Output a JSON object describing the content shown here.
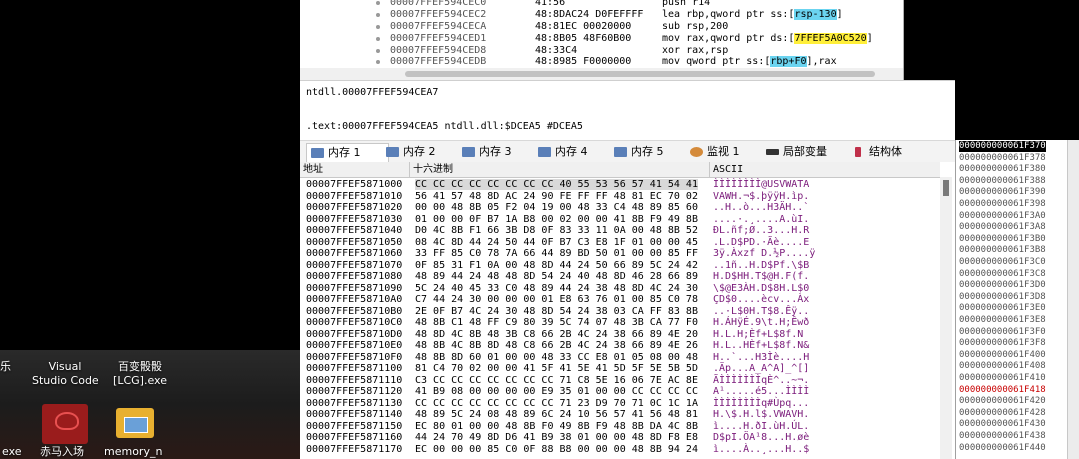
{
  "disasm": {
    "rows": [
      {
        "addr": "00007FFEF594CEC0",
        "bytes": "41:56",
        "ins": "push r14"
      },
      {
        "addr": "00007FFEF594CEC2",
        "bytes": "48:8DAC24 D0FEFFFF",
        "ins_pre": "lea rbp,qword ptr ss:[",
        "ins_hl": "rsp-130",
        "ins_post": "]",
        "hl": "cyan"
      },
      {
        "addr": "00007FFEF594CECA",
        "bytes": "48:81EC 00020000",
        "ins": "sub rsp,200"
      },
      {
        "addr": "00007FFEF594CED1",
        "bytes": "48:8B05 48F60B00",
        "ins_pre": "mov rax,qword ptr ds:[",
        "ins_hl": "7FFEF5A0C520",
        "ins_post": "]",
        "hl": "yellow"
      },
      {
        "addr": "00007FFEF594CED8",
        "bytes": "48:33C4",
        "ins": "xor rax,rsp"
      },
      {
        "addr": "00007FFEF594CEDB",
        "bytes": "48:8985 F0000000",
        "ins_pre": "mov qword ptr ss:[",
        "ins_hl": "rbp+F0",
        "ins_post": "],rax",
        "hl": "cyan"
      }
    ]
  },
  "info": {
    "line1": "ntdll.00007FFEF594CEA7",
    "line2": ".text:00007FFEF594CEA5 ntdll.dll:$DCEA5 #DCEA5"
  },
  "tabs": [
    {
      "label": "内存 1",
      "active": true,
      "color": "#5a7fb8"
    },
    {
      "label": "内存 2",
      "active": false,
      "color": "#5a7fb8"
    },
    {
      "label": "内存 3",
      "active": false,
      "color": "#5a7fb8"
    },
    {
      "label": "内存 4",
      "active": false,
      "color": "#5a7fb8"
    },
    {
      "label": "内存 5",
      "active": false,
      "color": "#5a7fb8"
    },
    {
      "label": "监视 1",
      "active": false,
      "color": "#d48a3a"
    },
    {
      "label": "局部变量",
      "active": false,
      "color": "#333333"
    },
    {
      "label": "结构体",
      "active": false,
      "color": "#c0304a"
    }
  ],
  "dump": {
    "headers": [
      "地址",
      "十六进制",
      "ASCII"
    ],
    "rows": [
      {
        "addr": "00007FFEF5871000",
        "hex": "CC CC CC CC CC CC CC CC 40 55 53 56 57 41 54 41",
        "ascii": "ÌÌÌÌÌÌÌÌ@USVWATA"
      },
      {
        "addr": "00007FFEF5871010",
        "hex": "56 41 57 48 8D AC 24 90 FE FF FF 48 81 EC 70 02",
        "ascii": "VAWH.¬$.þÿÿH.ìp."
      },
      {
        "addr": "00007FFEF5871020",
        "hex": "00 00 48 8B 05 F2 04 19 00 48 33 C4 48 89 85 60",
        "ascii": "..H..ò...H3ÄH..`"
      },
      {
        "addr": "00007FFEF5871030",
        "hex": "01 00 00 0F B7 1A B8 00 02 00 00 41 8B F9 49 8B",
        "ascii": "....·.¸....A.ùI."
      },
      {
        "addr": "00007FFEF5871040",
        "hex": "D0 4C 8B F1 66 3B D8 0F 83 33 11 0A 00 48 8B 52",
        "ascii": "ÐL.ñf;Ø..3...H.R"
      },
      {
        "addr": "00007FFEF5871050",
        "hex": "08 4C 8D 44 24 50 44 0F B7 C3 E8 1F 01 00 00 45",
        "ascii": ".L.D$PD.·Ãè....E"
      },
      {
        "addr": "00007FFEF5871060",
        "hex": "33 FF 85 C0 78 7A 66 44 89 BD 50 01 00 00 85 FF",
        "ascii": "3ÿ.Àxzf D.½P....ÿ"
      },
      {
        "addr": "00007FFEF5871070",
        "hex": "0F 85 31 F1 0A 00 48 8D 44 24 50 66 89 5C 24 42",
        "ascii": "..1ñ..H.D$Pf.\\$B"
      },
      {
        "addr": "00007FFEF5871080",
        "hex": "48 89 44 24 48 48 8D 54 24 40 48 8D 46 28 66 89",
        "ascii": "H.D$HH.T$@H.F(f."
      },
      {
        "addr": "00007FFEF5871090",
        "hex": "5C 24 40 45 33 C0 48 89 44 24 38 48 8D 4C 24 30",
        "ascii": "\\$@E3ÀH.D$8H.L$0"
      },
      {
        "addr": "00007FFEF58710A0",
        "hex": "C7 44 24 30 00 00 00 01 E8 63 76 01 00 85 C0 78",
        "ascii": "ÇD$0....ècv...Àx"
      },
      {
        "addr": "00007FFEF58710B0",
        "hex": "2E 0F B7 4C 24 30 48 8D 54 24 38 03 CA FF 83 8B",
        "ascii": "..·L$0H.T$8.Êÿ.."
      },
      {
        "addr": "00007FFEF58710C0",
        "hex": "48 8B C1 48 FF C9 80 39 5C 74 07 48 3B CA 77 F0",
        "ascii": "H.ÁHÿÉ.9\\t.H;Êwð"
      },
      {
        "addr": "00007FFEF58710D0",
        "hex": "48 8D 4C 8B 48 3B C8 66 2B 4C 24 38 66 89 4E 20",
        "ascii": "H.L.H;Èf+L$8f.N "
      },
      {
        "addr": "00007FFEF58710E0",
        "hex": "48 8B 4C 8B 8D 48 C8 66 2B 4C 24 38 66 89 4E 26",
        "ascii": "H.L..HÈf+L$8f.N&"
      },
      {
        "addr": "00007FFEF58710F0",
        "hex": "48 8B 8D 60 01 00 00 48 33 CC E8 01 05 08 00 48",
        "ascii": "H..`...H3Ìè....H"
      },
      {
        "addr": "00007FFEF5871100",
        "hex": "81 C4 70 02 00 00 41 5F 41 5E 41 5D 5F 5E 5B 5D",
        "ascii": ".Äp...A_A^A]_^[]"
      },
      {
        "addr": "00007FFEF5871110",
        "hex": "C3 CC CC CC CC CC CC CC 71 C8 5E 16 06 7E AC 8E",
        "ascii": "ÃÌÌÌÌÌÌÌqÈ^..~¬."
      },
      {
        "addr": "00007FFEF5871120",
        "hex": "41 B9 08 00 00 00 00 E9 35 01 00 00 CC CC CC CC",
        "ascii": "A¹.....é5...ÌÌÌÌ"
      },
      {
        "addr": "00007FFEF5871130",
        "hex": "CC CC CC CC CC CC CC CC 71 23 D9 70 71 0C 1C 1A",
        "ascii": "ÌÌÌÌÌÌÌÌq#Ùpq..."
      },
      {
        "addr": "00007FFEF5871140",
        "hex": "48 89 5C 24 08 48 89 6C 24 10 56 57 41 56 48 81",
        "ascii": "H.\\$.H.l$.VWAVH."
      },
      {
        "addr": "00007FFEF5871150",
        "hex": "EC 80 01 00 00 48 8B F0 49 8B F9 48 8B DA 4C 8B",
        "ascii": "ì....H.ðI.ùH.ÚL."
      },
      {
        "addr": "00007FFEF5871160",
        "hex": "44 24 70 49 8D D6 41 B9 38 01 00 00 48 8D F8 E8",
        "ascii": "D$pI.ÖA¹8...H.øè"
      },
      {
        "addr": "00007FFEF5871170",
        "hex": "EC 00 00 00 85 C0 0F 88 B8 00 00 00 48 8B 94 24",
        "ascii": "ì....À..¸...H..$"
      }
    ]
  },
  "stack": {
    "rows": [
      {
        "addr": "000000000061F370",
        "state": "sel"
      },
      {
        "addr": "000000000061F378",
        "state": ""
      },
      {
        "addr": "000000000061F380",
        "state": ""
      },
      {
        "addr": "000000000061F388",
        "state": ""
      },
      {
        "addr": "000000000061F390",
        "state": ""
      },
      {
        "addr": "000000000061F398",
        "state": ""
      },
      {
        "addr": "000000000061F3A0",
        "state": ""
      },
      {
        "addr": "000000000061F3A8",
        "state": ""
      },
      {
        "addr": "000000000061F3B0",
        "state": ""
      },
      {
        "addr": "000000000061F3B8",
        "state": ""
      },
      {
        "addr": "000000000061F3C0",
        "state": ""
      },
      {
        "addr": "000000000061F3C8",
        "state": ""
      },
      {
        "addr": "000000000061F3D0",
        "state": ""
      },
      {
        "addr": "000000000061F3D8",
        "state": ""
      },
      {
        "addr": "000000000061F3E0",
        "state": ""
      },
      {
        "addr": "000000000061F3E8",
        "state": ""
      },
      {
        "addr": "000000000061F3F0",
        "state": ""
      },
      {
        "addr": "000000000061F3F8",
        "state": ""
      },
      {
        "addr": "000000000061F400",
        "state": ""
      },
      {
        "addr": "000000000061F408",
        "state": ""
      },
      {
        "addr": "000000000061F410",
        "state": ""
      },
      {
        "addr": "000000000061F418",
        "state": "red"
      },
      {
        "addr": "000000000061F420",
        "state": ""
      },
      {
        "addr": "000000000061F428",
        "state": ""
      },
      {
        "addr": "000000000061F430",
        "state": ""
      },
      {
        "addr": "000000000061F438",
        "state": ""
      },
      {
        "addr": "000000000061F440",
        "state": ""
      }
    ]
  },
  "desktop": {
    "icons": [
      {
        "label": "Visual\nStudio Code",
        "color": "#2a2a2a"
      },
      {
        "label": "百变骰骰\n[LCG].exe",
        "color": "#2a2a2a"
      },
      {
        "label": "赤马入场",
        "color": "#b02020"
      },
      {
        "label": "memory_n",
        "color": "#e8b030"
      }
    ],
    "fragment_left": "乐",
    "fragment_left2": "exe"
  }
}
